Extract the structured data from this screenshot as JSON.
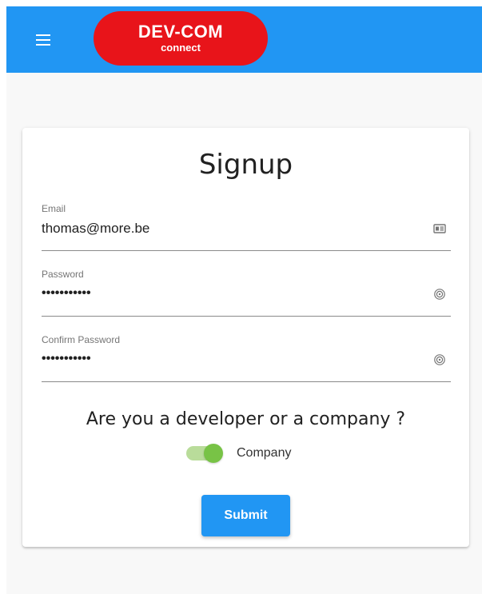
{
  "header": {
    "logo_title": "DEV-COM",
    "logo_subtitle": "connect",
    "brand_color": "#e8141a",
    "bar_color": "#2196f3",
    "menu_icon": "hamburger-menu-icon"
  },
  "signup": {
    "title": "Signup",
    "email": {
      "label": "Email",
      "value": "thomas@more.be",
      "icon": "id-card-icon"
    },
    "password": {
      "label": "Password",
      "value": "•••••••••••",
      "icon": "fingerprint-icon"
    },
    "confirm_password": {
      "label": "Confirm Password",
      "value": "•••••••••••",
      "icon": "fingerprint-icon"
    },
    "question": "Are you a developer or a company ?",
    "toggle": {
      "label": "Company",
      "checked": true,
      "color": "#78c346"
    },
    "submit_label": "Submit"
  }
}
